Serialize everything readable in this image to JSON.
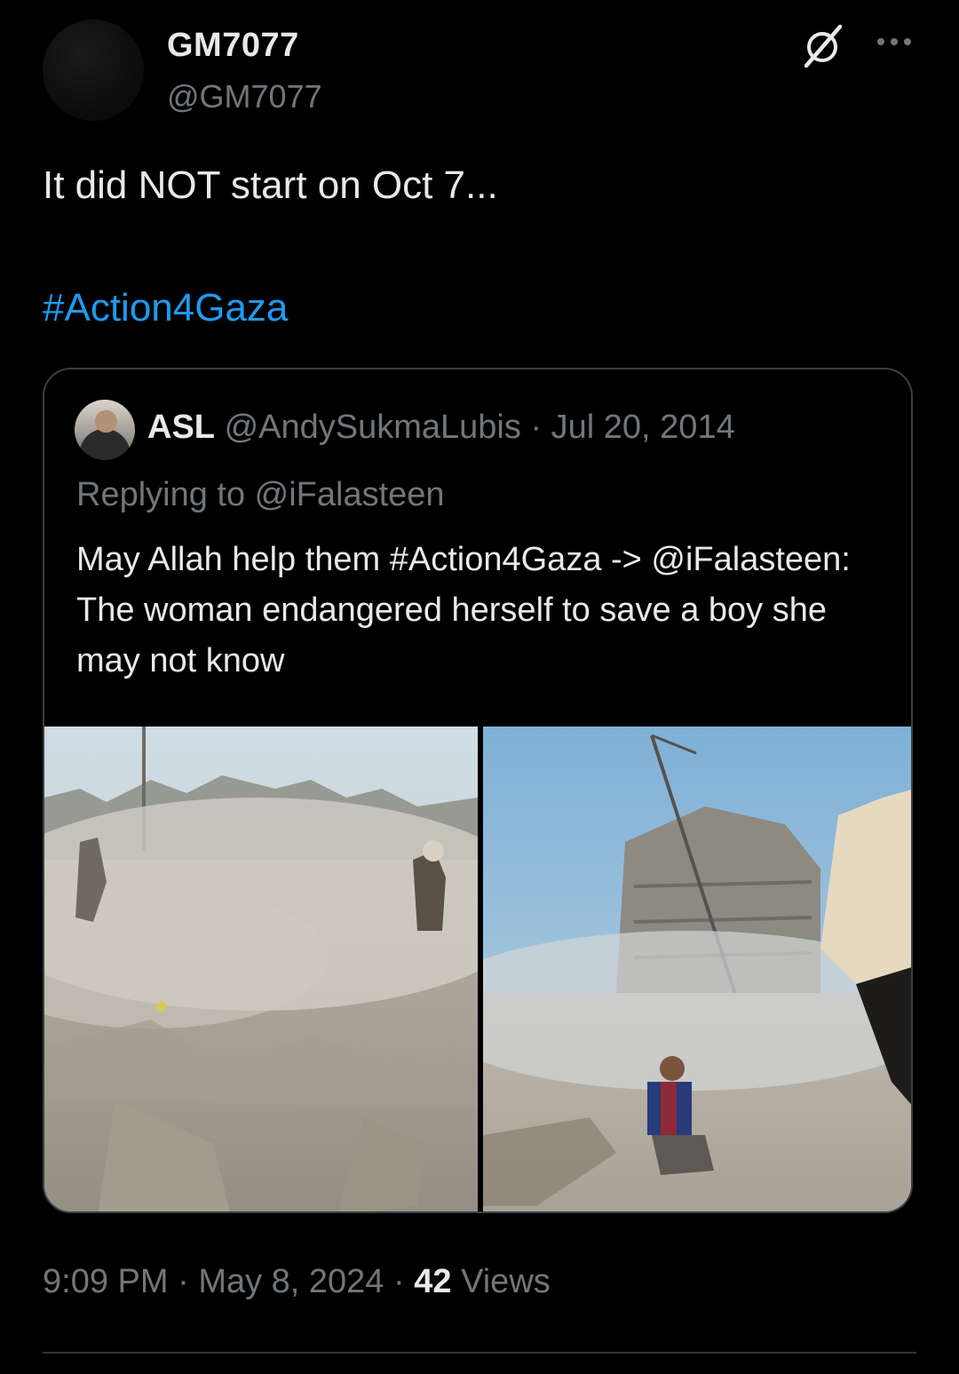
{
  "tweet": {
    "author": {
      "display_name": "GM7077",
      "handle": "@GM7077"
    },
    "text": "It did NOT start on Oct 7...",
    "hashtag": "#Action4Gaza",
    "icons": {
      "grok": "grok-icon",
      "more": "more-icon"
    },
    "quoted": {
      "name": "ASL",
      "handle": "@AndySukmaLubis",
      "separator": "·",
      "date": "Jul 20, 2014",
      "replying_to": "Replying to @iFalasteen",
      "text": "May Allah help them #Action4Gaza -> @iFalasteen: The woman endangered herself to save a boy she may not know"
    },
    "footer": {
      "time": "9:09 PM",
      "date": "May 8, 2024",
      "separator": "·",
      "views_count": "42",
      "views_label": "Views"
    }
  },
  "colors": {
    "background": "#000000",
    "text": "#e7e9ea",
    "muted": "#71767b",
    "link": "#1d9bf0",
    "border": "#3a3f44"
  }
}
